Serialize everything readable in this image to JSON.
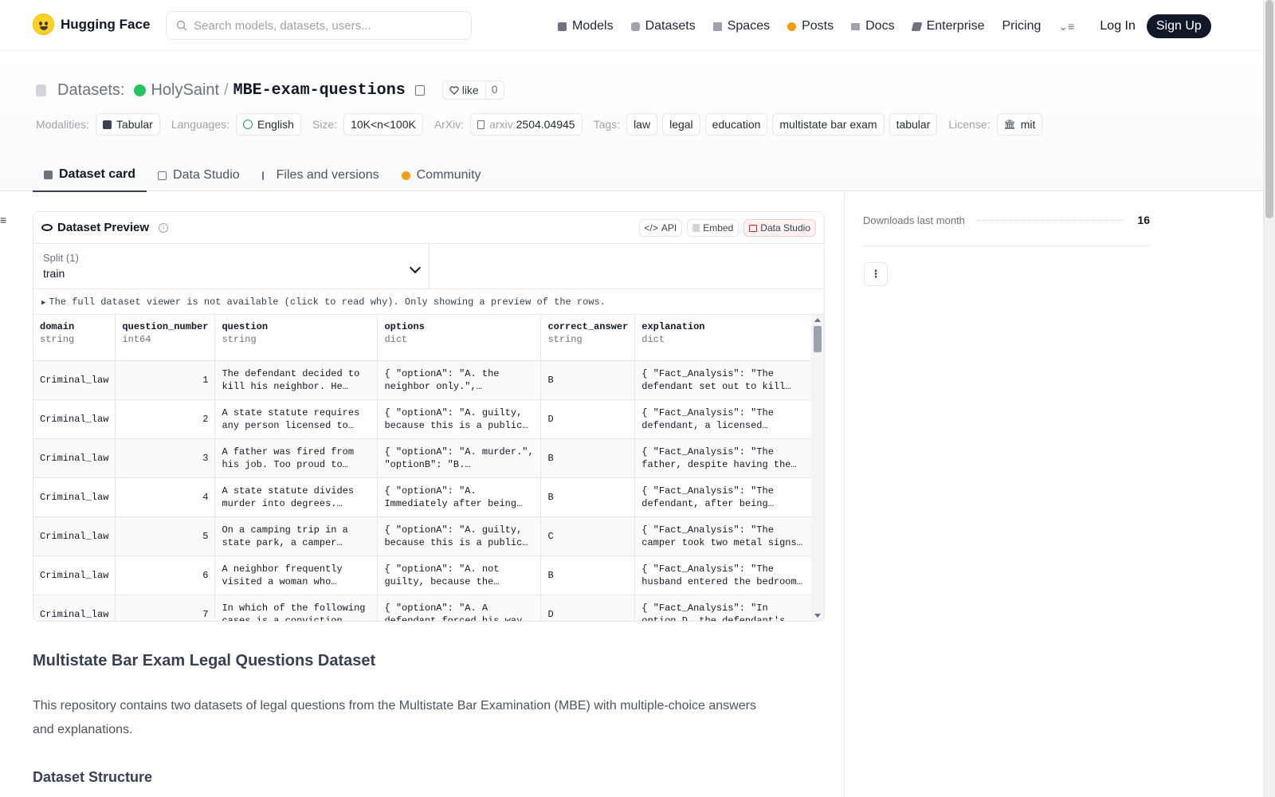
{
  "nav": {
    "brand": "Hugging Face",
    "search_placeholder": "Search models, datasets, users...",
    "links": [
      {
        "label": "Models",
        "icon": "cube-icon"
      },
      {
        "label": "Datasets",
        "icon": "database-icon"
      },
      {
        "label": "Spaces",
        "icon": "grid-icon"
      },
      {
        "label": "Posts",
        "icon": "dot-icon"
      },
      {
        "label": "Docs",
        "icon": "book-icon"
      },
      {
        "label": "Enterprise",
        "icon": "enterprise-icon"
      },
      {
        "label": "Pricing",
        "icon": ""
      }
    ],
    "login": "Log In",
    "signup": "Sign Up"
  },
  "repo": {
    "section": "Datasets:",
    "owner": "HolySaint",
    "slash": "/",
    "name": "MBE-exam-questions",
    "like_label": "like",
    "like_count": "0"
  },
  "meta": {
    "modalities_label": "Modalities:",
    "modality": "Tabular",
    "languages_label": "Languages:",
    "language": "English",
    "size_label": "Size:",
    "size": "10K<n<100K",
    "arxiv_label": "ArXiv:",
    "arxiv_prefix": "arxiv:",
    "arxiv_id": "2504.04945",
    "tags_label": "Tags:",
    "tags": [
      "law",
      "legal",
      "education",
      "multistate bar exam",
      "tabular"
    ],
    "license_label": "License:",
    "license": "mit"
  },
  "tabs": [
    {
      "label": "Dataset card"
    },
    {
      "label": "Data Studio"
    },
    {
      "label": "Files and versions"
    },
    {
      "label": "Community"
    }
  ],
  "preview": {
    "title": "Dataset Preview",
    "api": "API",
    "embed": "Embed",
    "studio": "Data Studio",
    "split_label": "Split (1)",
    "split_value": "train",
    "notice": "The full dataset viewer is not available (click to read why). Only showing a preview of the rows.",
    "columns": [
      {
        "name": "domain",
        "type": "string"
      },
      {
        "name": "question_number",
        "type": "int64"
      },
      {
        "name": "question",
        "type": "string"
      },
      {
        "name": "options",
        "type": "dict"
      },
      {
        "name": "correct_answer",
        "type": "string"
      },
      {
        "name": "explanation",
        "type": "dict"
      }
    ],
    "rows": [
      [
        "Criminal_law",
        "1",
        "The defendant decided to kill his neighbor. He set…",
        "{ \"optionA\": \"A. the neighbor only.\", \"optionB\"…",
        "B",
        "{ \"Fact_Analysis\": \"The defendant set out to kill hi…"
      ],
      [
        "Criminal_law",
        "2",
        "A state statute requires any person licensed to sel…",
        "{ \"optionA\": \"A. guilty, because this is a public…",
        "D",
        "{ \"Fact_Analysis\": \"The defendant, a licensed…"
      ],
      [
        "Criminal_law",
        "3",
        "A father was fired from his job. Too proud to apply fo…",
        "{ \"optionA\": \"A. murder.\", \"optionB\": \"B. involuntary…",
        "B",
        "{ \"Fact_Analysis\": \"The father, despite having the…"
      ],
      [
        "Criminal_law",
        "4",
        "A state statute divides murder into degrees. First…",
        "{ \"optionA\": \"A. Immediately after being…",
        "B",
        "{ \"Fact_Analysis\": \"The defendant, after being…"
      ],
      [
        "Criminal_law",
        "5",
        "On a camping trip in a state park, a camper…",
        "{ \"optionA\": \"A. guilty, because this is a public…",
        "C",
        "{ \"Fact_Analysis\": \"The camper took two metal signs…"
      ],
      [
        "Criminal_law",
        "6",
        "A neighbor frequently visited a woman who lived…",
        "{ \"optionA\": \"A. not guilty, because the…",
        "B",
        "{ \"Fact_Analysis\": \"The husband entered the bedroom…"
      ],
      [
        "Criminal_law",
        "7",
        "In which of the following cases is a conviction for…",
        "{ \"optionA\": \"A. A defendant forced his way…",
        "D",
        "{ \"Fact_Analysis\": \"In option D, the defendant's actions…"
      ]
    ]
  },
  "readme": {
    "h1": "Multistate Bar Exam Legal Questions Dataset",
    "p": "This repository contains two datasets of legal questions from the Multistate Bar Examination (MBE) with multiple-choice answers and explanations.",
    "h2": "Dataset Structure"
  },
  "sidebar": {
    "downloads_label": "Downloads last month",
    "downloads_value": "16"
  },
  "colors": {
    "accent_dark": "#111827",
    "owner_dot": "#22c55e",
    "posts": "#f59e0b",
    "studio_red": "#dc2626"
  }
}
